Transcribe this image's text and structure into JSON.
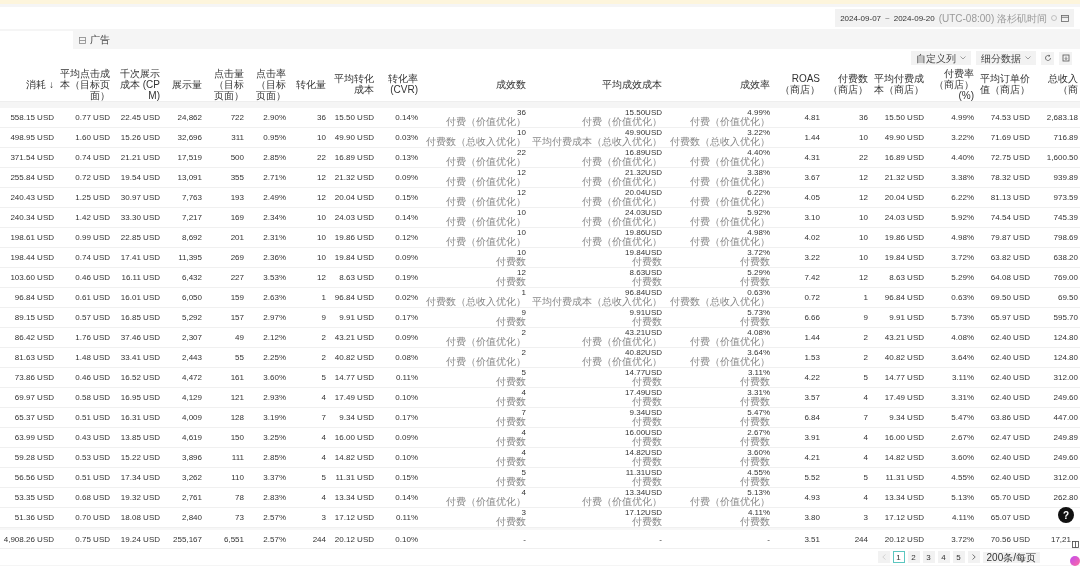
{
  "date_range": {
    "start": "2024-09-07",
    "separator": "~",
    "end": "2024-09-20",
    "timezone": "(UTC-08:00) 洛杉矶时间"
  },
  "tabs": [
    {
      "label": "广告",
      "selected": true
    }
  ],
  "toolbar_buttons": [
    {
      "label": "自定义列"
    },
    {
      "label": "细分数据"
    }
  ],
  "columns": [
    "消耗 ↓",
    "平均点击成本（目标页面）",
    "千次展示成本 (CPM)",
    "展示量",
    "点击量（目标页面）",
    "点击率（目标页面）",
    "转化量",
    "平均转化成本",
    "转化率 (CVR)",
    "成效数",
    "平均成效成本",
    "成效率",
    "ROAS（商店）",
    "付费数（商店）",
    "平均付费成本（商店）",
    "付费率（商店）(%)",
    "平均订单价值（商店）",
    "总收入（商"
  ],
  "rows": [
    {
      "cells": [
        "558.15 USD",
        "0.77 USD",
        "22.45 USD",
        "24,862",
        "722",
        "2.90%",
        "36",
        "15.50 USD",
        "0.14%"
      ],
      "results": [
        {
          "value": "36",
          "note": "付费（价值优化）"
        },
        {
          "value": "15.50USD",
          "note": "付费（价值优化）"
        },
        {
          "value": "4.99%",
          "note": "付费（价值优化）"
        }
      ],
      "store": [
        "4.81",
        "36",
        "15.50 USD",
        "4.99%",
        "74.53 USD",
        "2,683.18"
      ]
    },
    {
      "cells": [
        "498.95 USD",
        "1.60 USD",
        "15.26 USD",
        "32,696",
        "311",
        "0.95%",
        "10",
        "49.90 USD",
        "0.03%"
      ],
      "results": [
        {
          "value": "10",
          "note": "付费数（总收入优化）"
        },
        {
          "value": "49.90USD",
          "note": "平均付费成本（总收入优化）"
        },
        {
          "value": "3.22%",
          "note": "付费数（总收入优化）"
        }
      ],
      "store": [
        "1.44",
        "10",
        "49.90 USD",
        "3.22%",
        "71.69 USD",
        "716.89"
      ]
    },
    {
      "cells": [
        "371.54 USD",
        "0.74 USD",
        "21.21 USD",
        "17,519",
        "500",
        "2.85%",
        "22",
        "16.89 USD",
        "0.13%"
      ],
      "results": [
        {
          "value": "22",
          "note": "付费（价值优化）"
        },
        {
          "value": "16.89USD",
          "note": "付费（价值优化）"
        },
        {
          "value": "4.40%",
          "note": "付费（价值优化）"
        }
      ],
      "store": [
        "4.31",
        "22",
        "16.89 USD",
        "4.40%",
        "72.75 USD",
        "1,600.50"
      ]
    },
    {
      "cells": [
        "255.84 USD",
        "0.72 USD",
        "19.54 USD",
        "13,091",
        "355",
        "2.71%",
        "12",
        "21.32 USD",
        "0.09%"
      ],
      "results": [
        {
          "value": "12",
          "note": "付费（价值优化）"
        },
        {
          "value": "21.32USD",
          "note": "付费（价值优化）"
        },
        {
          "value": "3.38%",
          "note": "付费（价值优化）"
        }
      ],
      "store": [
        "3.67",
        "12",
        "21.32 USD",
        "3.38%",
        "78.32 USD",
        "939.89"
      ]
    },
    {
      "cells": [
        "240.43 USD",
        "1.25 USD",
        "30.97 USD",
        "7,763",
        "193",
        "2.49%",
        "12",
        "20.04 USD",
        "0.15%"
      ],
      "results": [
        {
          "value": "12",
          "note": "付费（价值优化）"
        },
        {
          "value": "20.04USD",
          "note": "付费（价值优化）"
        },
        {
          "value": "6.22%",
          "note": "付费（价值优化）"
        }
      ],
      "store": [
        "4.05",
        "12",
        "20.04 USD",
        "6.22%",
        "81.13 USD",
        "973.59"
      ]
    },
    {
      "cells": [
        "240.34 USD",
        "1.42 USD",
        "33.30 USD",
        "7,217",
        "169",
        "2.34%",
        "10",
        "24.03 USD",
        "0.14%"
      ],
      "results": [
        {
          "value": "10",
          "note": "付费（价值优化）"
        },
        {
          "value": "24.03USD",
          "note": "付费（价值优化）"
        },
        {
          "value": "5.92%",
          "note": "付费（价值优化）"
        }
      ],
      "store": [
        "3.10",
        "10",
        "24.03 USD",
        "5.92%",
        "74.54 USD",
        "745.39"
      ]
    },
    {
      "cells": [
        "198.61 USD",
        "0.99 USD",
        "22.85 USD",
        "8,692",
        "201",
        "2.31%",
        "10",
        "19.86 USD",
        "0.12%"
      ],
      "results": [
        {
          "value": "10",
          "note": "付费（价值优化）"
        },
        {
          "value": "19.86USD",
          "note": "付费（价值优化）"
        },
        {
          "value": "4.98%",
          "note": "付费（价值优化）"
        }
      ],
      "store": [
        "4.02",
        "10",
        "19.86 USD",
        "4.98%",
        "79.87 USD",
        "798.69"
      ]
    },
    {
      "cells": [
        "198.44 USD",
        "0.74 USD",
        "17.41 USD",
        "11,395",
        "269",
        "2.36%",
        "10",
        "19.84 USD",
        "0.09%"
      ],
      "results": [
        {
          "value": "10",
          "note": "付费数"
        },
        {
          "value": "19.84USD",
          "note": "付费数"
        },
        {
          "value": "3.72%",
          "note": "付费数"
        }
      ],
      "store": [
        "3.22",
        "10",
        "19.84 USD",
        "3.72%",
        "63.82 USD",
        "638.20"
      ]
    },
    {
      "cells": [
        "103.60 USD",
        "0.46 USD",
        "16.11 USD",
        "6,432",
        "227",
        "3.53%",
        "12",
        "8.63 USD",
        "0.19%"
      ],
      "results": [
        {
          "value": "12",
          "note": "付费数"
        },
        {
          "value": "8.63USD",
          "note": "付费数"
        },
        {
          "value": "5.29%",
          "note": "付费数"
        }
      ],
      "store": [
        "7.42",
        "12",
        "8.63 USD",
        "5.29%",
        "64.08 USD",
        "769.00"
      ]
    },
    {
      "cells": [
        "96.84 USD",
        "0.61 USD",
        "16.01 USD",
        "6,050",
        "159",
        "2.63%",
        "1",
        "96.84 USD",
        "0.02%"
      ],
      "results": [
        {
          "value": "1",
          "note": "付费数（总收入优化）"
        },
        {
          "value": "96.84USD",
          "note": "平均付费成本（总收入优化）"
        },
        {
          "value": "0.63%",
          "note": "付费数（总收入优化）"
        }
      ],
      "store": [
        "0.72",
        "1",
        "96.84 USD",
        "0.63%",
        "69.50 USD",
        "69.50"
      ]
    },
    {
      "cells": [
        "89.15 USD",
        "0.57 USD",
        "16.85 USD",
        "5,292",
        "157",
        "2.97%",
        "9",
        "9.91 USD",
        "0.17%"
      ],
      "results": [
        {
          "value": "9",
          "note": "付费数"
        },
        {
          "value": "9.91USD",
          "note": "付费数"
        },
        {
          "value": "5.73%",
          "note": "付费数"
        }
      ],
      "store": [
        "6.66",
        "9",
        "9.91 USD",
        "5.73%",
        "65.97 USD",
        "595.70"
      ]
    },
    {
      "cells": [
        "86.42 USD",
        "1.76 USD",
        "37.46 USD",
        "2,307",
        "49",
        "2.12%",
        "2",
        "43.21 USD",
        "0.09%"
      ],
      "results": [
        {
          "value": "2",
          "note": "付费（价值优化）"
        },
        {
          "value": "43.21USD",
          "note": "付费（价值优化）"
        },
        {
          "value": "4.08%",
          "note": "付费（价值优化）"
        }
      ],
      "store": [
        "1.44",
        "2",
        "43.21 USD",
        "4.08%",
        "62.40 USD",
        "124.80"
      ]
    },
    {
      "cells": [
        "81.63 USD",
        "1.48 USD",
        "33.41 USD",
        "2,443",
        "55",
        "2.25%",
        "2",
        "40.82 USD",
        "0.08%"
      ],
      "results": [
        {
          "value": "2",
          "note": "付费（价值优化）"
        },
        {
          "value": "40.82USD",
          "note": "付费（价值优化）"
        },
        {
          "value": "3.64%",
          "note": "付费（价值优化）"
        }
      ],
      "store": [
        "1.53",
        "2",
        "40.82 USD",
        "3.64%",
        "62.40 USD",
        "124.80"
      ]
    },
    {
      "cells": [
        "73.86 USD",
        "0.46 USD",
        "16.52 USD",
        "4,472",
        "161",
        "3.60%",
        "5",
        "14.77 USD",
        "0.11%"
      ],
      "results": [
        {
          "value": "5",
          "note": "付费数"
        },
        {
          "value": "14.77USD",
          "note": "付费数"
        },
        {
          "value": "3.11%",
          "note": "付费数"
        }
      ],
      "store": [
        "4.22",
        "5",
        "14.77 USD",
        "3.11%",
        "62.40 USD",
        "312.00"
      ]
    },
    {
      "cells": [
        "69.97 USD",
        "0.58 USD",
        "16.95 USD",
        "4,129",
        "121",
        "2.93%",
        "4",
        "17.49 USD",
        "0.10%"
      ],
      "results": [
        {
          "value": "4",
          "note": "付费数"
        },
        {
          "value": "17.49USD",
          "note": "付费数"
        },
        {
          "value": "3.31%",
          "note": "付费数"
        }
      ],
      "store": [
        "3.57",
        "4",
        "17.49 USD",
        "3.31%",
        "62.40 USD",
        "249.60"
      ]
    },
    {
      "cells": [
        "65.37 USD",
        "0.51 USD",
        "16.31 USD",
        "4,009",
        "128",
        "3.19%",
        "7",
        "9.34 USD",
        "0.17%"
      ],
      "results": [
        {
          "value": "7",
          "note": "付费数"
        },
        {
          "value": "9.34USD",
          "note": "付费数"
        },
        {
          "value": "5.47%",
          "note": "付费数"
        }
      ],
      "store": [
        "6.84",
        "7",
        "9.34 USD",
        "5.47%",
        "63.86 USD",
        "447.00"
      ]
    },
    {
      "cells": [
        "63.99 USD",
        "0.43 USD",
        "13.85 USD",
        "4,619",
        "150",
        "3.25%",
        "4",
        "16.00 USD",
        "0.09%"
      ],
      "results": [
        {
          "value": "4",
          "note": "付费数"
        },
        {
          "value": "16.00USD",
          "note": "付费数"
        },
        {
          "value": "2.67%",
          "note": "付费数"
        }
      ],
      "store": [
        "3.91",
        "4",
        "16.00 USD",
        "2.67%",
        "62.47 USD",
        "249.89"
      ]
    },
    {
      "cells": [
        "59.28 USD",
        "0.53 USD",
        "15.22 USD",
        "3,896",
        "111",
        "2.85%",
        "4",
        "14.82 USD",
        "0.10%"
      ],
      "results": [
        {
          "value": "4",
          "note": "付费数"
        },
        {
          "value": "14.82USD",
          "note": "付费数"
        },
        {
          "value": "3.60%",
          "note": "付费数"
        }
      ],
      "store": [
        "4.21",
        "4",
        "14.82 USD",
        "3.60%",
        "62.40 USD",
        "249.60"
      ]
    },
    {
      "cells": [
        "56.56 USD",
        "0.51 USD",
        "17.34 USD",
        "3,262",
        "110",
        "3.37%",
        "5",
        "11.31 USD",
        "0.15%"
      ],
      "results": [
        {
          "value": "5",
          "note": "付费数"
        },
        {
          "value": "11.31USD",
          "note": "付费数"
        },
        {
          "value": "4.55%",
          "note": "付费数"
        }
      ],
      "store": [
        "5.52",
        "5",
        "11.31 USD",
        "4.55%",
        "62.40 USD",
        "312.00"
      ]
    },
    {
      "cells": [
        "53.35 USD",
        "0.68 USD",
        "19.32 USD",
        "2,761",
        "78",
        "2.83%",
        "4",
        "13.34 USD",
        "0.14%"
      ],
      "results": [
        {
          "value": "4",
          "note": "付费（价值优化）"
        },
        {
          "value": "13.34USD",
          "note": "付费（价值优化）"
        },
        {
          "value": "5.13%",
          "note": "付费（价值优化）"
        }
      ],
      "store": [
        "4.93",
        "4",
        "13.34 USD",
        "5.13%",
        "65.70 USD",
        "262.80"
      ]
    },
    {
      "cells": [
        "51.36 USD",
        "0.70 USD",
        "18.08 USD",
        "2,840",
        "73",
        "2.57%",
        "3",
        "17.12 USD",
        "0.11%"
      ],
      "results": [
        {
          "value": "3",
          "note": "付费数"
        },
        {
          "value": "17.12USD",
          "note": "付费数"
        },
        {
          "value": "4.11%",
          "note": "付费数"
        }
      ],
      "store": [
        "3.80",
        "3",
        "17.12 USD",
        "4.11%",
        "65.07 USD"
      ]
    }
  ],
  "total": {
    "cells": [
      "4,908.26 USD",
      "0.75 USD",
      "19.24 USD",
      "255,167",
      "6,551",
      "2.57%",
      "244",
      "20.12 USD",
      "0.10%"
    ],
    "results": [
      {
        "value": "-"
      },
      {
        "value": "-"
      },
      {
        "value": "-"
      }
    ],
    "store": [
      "3.51",
      "244",
      "20.12 USD",
      "3.72%",
      "70.56 USD",
      "17,21"
    ]
  },
  "pagination": {
    "prev_disabled": true,
    "next_disabled": false,
    "pages": [
      {
        "label": "1",
        "selected": true
      },
      {
        "label": "2",
        "selected": false
      },
      {
        "label": "3",
        "selected": false
      },
      {
        "label": "4",
        "selected": false
      },
      {
        "label": "5",
        "selected": false
      }
    ],
    "page_size": "200条/每页"
  },
  "help_button": "?"
}
